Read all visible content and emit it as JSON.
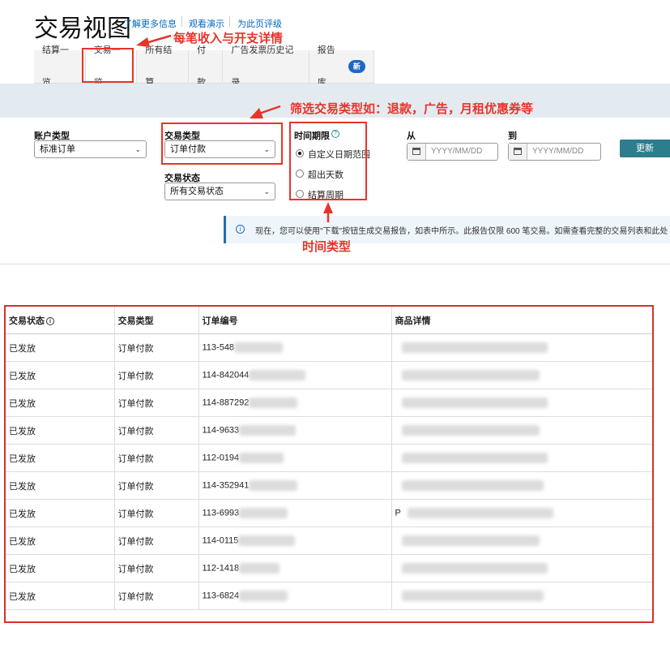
{
  "header": {
    "title": "交易视图",
    "links": [
      "了解更多信息",
      "观看演示",
      "为此页评级"
    ]
  },
  "tabs": [
    {
      "label": "结算一览"
    },
    {
      "label": "交易一览"
    },
    {
      "label": "所有结算"
    },
    {
      "label": "付款"
    },
    {
      "label": "广告发票历史记录"
    },
    {
      "label": "报告库",
      "badge": "新"
    }
  ],
  "filters": {
    "account_type": {
      "label": "账户类型",
      "value": "标准订单"
    },
    "transaction_type": {
      "label": "交易类型",
      "value": "订单付款"
    },
    "transaction_status": {
      "label": "交易状态",
      "value": "所有交易状态"
    },
    "time_range": {
      "label": "时间期限",
      "options": [
        "自定义日期范围",
        "超出天数",
        "结算周期"
      ],
      "selected": 0
    },
    "from": {
      "label": "从",
      "placeholder": "YYYY/MM/DD"
    },
    "to": {
      "label": "到",
      "placeholder": "YYYY/MM/DD"
    },
    "update_button": "更新"
  },
  "info_message": "现在，您可以使用\"下载\"按钮生成交易报告，如表中所示。此报告仅限 600 笔交易。如需查看完整的交易列表和此处",
  "annotations": {
    "tab_note": "每笔收入与开支详情",
    "type_note": "筛选交易类型如：退款，广告，月租优惠券等",
    "time_note": "时间类型"
  },
  "table": {
    "columns": [
      "交易状态",
      "交易类型",
      "订单编号",
      "商品详情"
    ],
    "rows": [
      {
        "status": "已发放",
        "type": "订单付款",
        "order": "113-548",
        "detail": ""
      },
      {
        "status": "已发放",
        "type": "订单付款",
        "order": "114-842044",
        "detail": ""
      },
      {
        "status": "已发放",
        "type": "订单付款",
        "order": "114-887292",
        "detail": ""
      },
      {
        "status": "已发放",
        "type": "订单付款",
        "order": "114-9633",
        "detail": ""
      },
      {
        "status": "已发放",
        "type": "订单付款",
        "order": "112-0194",
        "detail": ""
      },
      {
        "status": "已发放",
        "type": "订单付款",
        "order": "114-352941",
        "detail": ""
      },
      {
        "status": "已发放",
        "type": "订单付款",
        "order": "113-6993",
        "detail": "P"
      },
      {
        "status": "已发放",
        "type": "订单付款",
        "order": "114-0115",
        "detail": ""
      },
      {
        "status": "已发放",
        "type": "订单付款",
        "order": "112-1418",
        "detail": ""
      },
      {
        "status": "已发放",
        "type": "订单付款",
        "order": "113-6824",
        "detail": ""
      }
    ]
  }
}
